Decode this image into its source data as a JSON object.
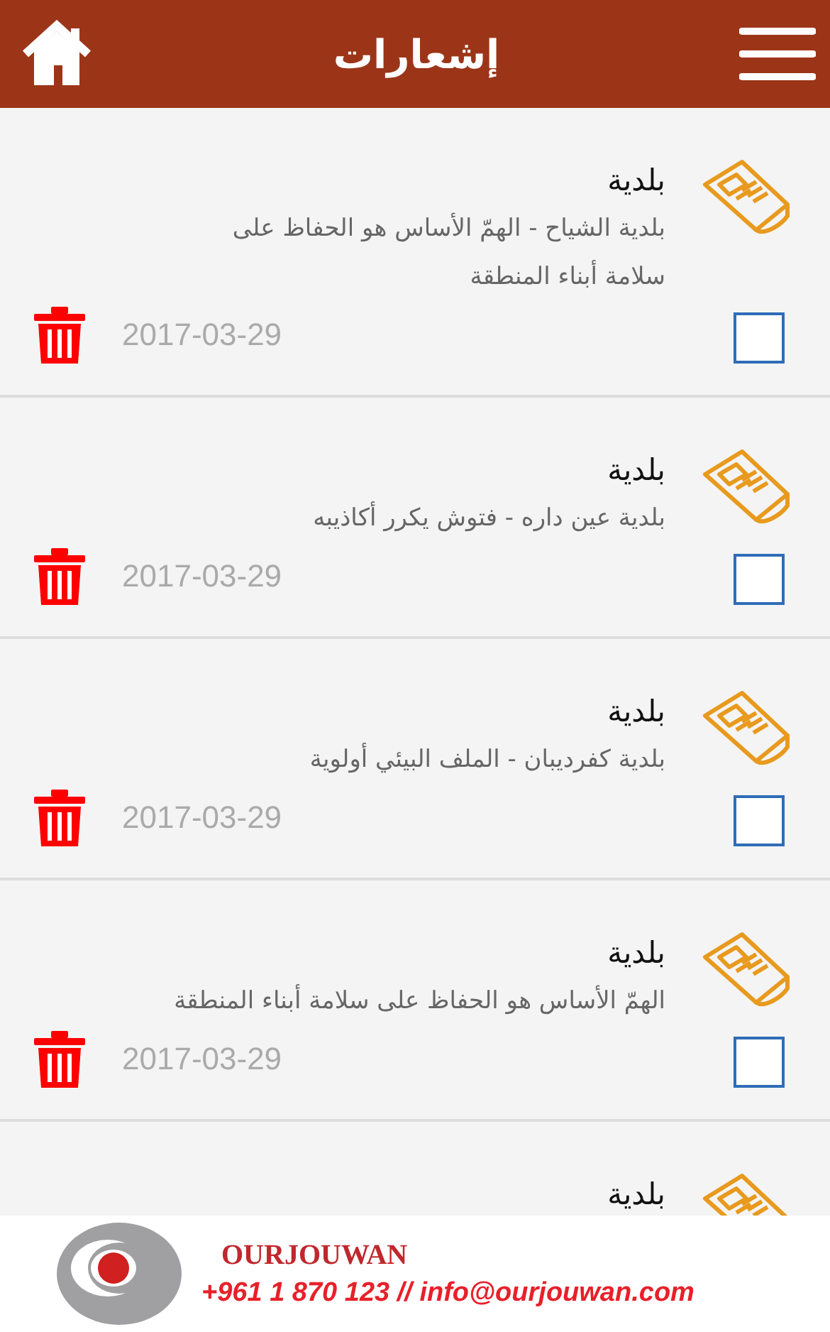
{
  "header": {
    "title": "إشعارات"
  },
  "notifications": [
    {
      "title": "بلدية",
      "body": "بلدية الشياح - الهمّ الأساس هو الحفاظ على سلامة أبناء المنطقة",
      "date": "2017-03-29",
      "checked": false
    },
    {
      "title": "بلدية",
      "body": "بلدية عين داره - فتوش يكرر أكاذيبه",
      "date": "2017-03-29",
      "checked": false
    },
    {
      "title": "بلدية",
      "body": "بلدية كفرديبان - الملف البيئي أولوية",
      "date": "2017-03-29",
      "checked": false
    },
    {
      "title": "بلدية",
      "body": "الهمّ الأساس هو الحفاظ على سلامة أبناء المنطقة",
      "date": "2017-03-29",
      "checked": false
    },
    {
      "title": "بلدية"
    }
  ],
  "banner": {
    "name": "OURJOUWAN",
    "contact": "+961 1 870 123 // info@ourjouwan.com"
  }
}
